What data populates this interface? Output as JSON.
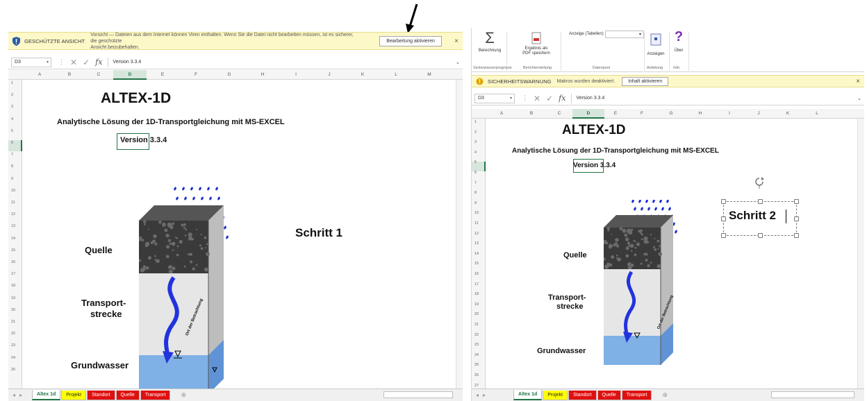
{
  "left_window": {
    "protected_view": {
      "title": "GESCHÜTZTE ANSICHT",
      "message_line1": "Vorsicht — Dateien aus dem Internet können Viren enthalten. Wenn Sie die Datei nicht bearbeiten müssen, ist es sicherer, die geschützte",
      "message_line2": "Ansicht beizubehalten.",
      "button": "Bearbeitung aktivieren",
      "close": "×"
    },
    "formula_bar": {
      "name_box": "D3",
      "value": "Version 3.3.4"
    },
    "columns": [
      "A",
      "B",
      "C",
      "D",
      "E",
      "F",
      "G",
      "H",
      "I",
      "J",
      "K",
      "L",
      "M"
    ],
    "rows": [
      "1",
      "2",
      "3",
      "4",
      "5",
      "6",
      "7",
      "8",
      "9",
      "10",
      "11",
      "12",
      "13",
      "14",
      "15",
      "16",
      "17",
      "18",
      "19",
      "20",
      "21",
      "22",
      "23",
      "24",
      "25"
    ],
    "sheet": {
      "title": "ALTEX-1D",
      "subtitle": "Analytische Lösung der 1D-Transportgleichung mit MS-EXCEL",
      "version": "Version 3.3.4",
      "label_source": "Quelle",
      "label_transport_1": "Transport-",
      "label_transport_2": "strecke",
      "label_groundwater": "Grundwasser",
      "label_side": "Ort der Betrachtung",
      "step": "Schritt 1"
    },
    "tabs": [
      "Altex 1d",
      "Projekt",
      "Standort",
      "Quelle",
      "Transport"
    ]
  },
  "right_window": {
    "ribbon": {
      "sum_button": "Berechnung",
      "pdf_button_1": "Ergebnis als",
      "pdf_button_2": "PDF speichern",
      "display_label": "Anzeige (Tabellen)",
      "show_button": "Anzeigen",
      "about_button": "Über",
      "groups": [
        "Sickerwasserprognose",
        "Berichterstellung",
        "Datenpool",
        "Anleitung",
        "Info"
      ]
    },
    "security_warning": {
      "title": "SICHERHEITSWARNUNG",
      "message": "Makros wurden deaktiviert.",
      "button": "Inhalt aktivieren",
      "close": "×"
    },
    "formula_bar": {
      "name_box": "D3",
      "value": "Version 3.3.4"
    },
    "columns": [
      "A",
      "B",
      "C",
      "D",
      "E",
      "F",
      "G",
      "H",
      "I",
      "J",
      "K",
      "L"
    ],
    "rows": [
      "1",
      "2",
      "3",
      "4",
      "5",
      "6",
      "7",
      "8",
      "9",
      "10",
      "11",
      "12",
      "13",
      "14",
      "15",
      "16",
      "17",
      "18",
      "19",
      "20",
      "21",
      "22",
      "23",
      "24",
      "25",
      "26",
      "27"
    ],
    "sheet": {
      "title": "ALTEX-1D",
      "subtitle": "Analytische Lösung der 1D-Transportgleichung mit MS-EXCEL",
      "version": "Version 3.3.4",
      "label_source": "Quelle",
      "label_transport_1": "Transport-",
      "label_transport_2": "strecke",
      "label_groundwater": "Grundwasser",
      "label_side": "Ort der Betrachtung",
      "step": "Schritt 2"
    },
    "tabs": [
      "Altex 1d",
      "Projekt",
      "Standort",
      "Quelle",
      "Transport"
    ]
  },
  "colors": {
    "excel_green": "#217346",
    "warning_bg": "#fdf8c7",
    "tab_yellow": "#ffff00",
    "tab_red": "#e01010",
    "rain_blue": "#1a2fd0"
  }
}
